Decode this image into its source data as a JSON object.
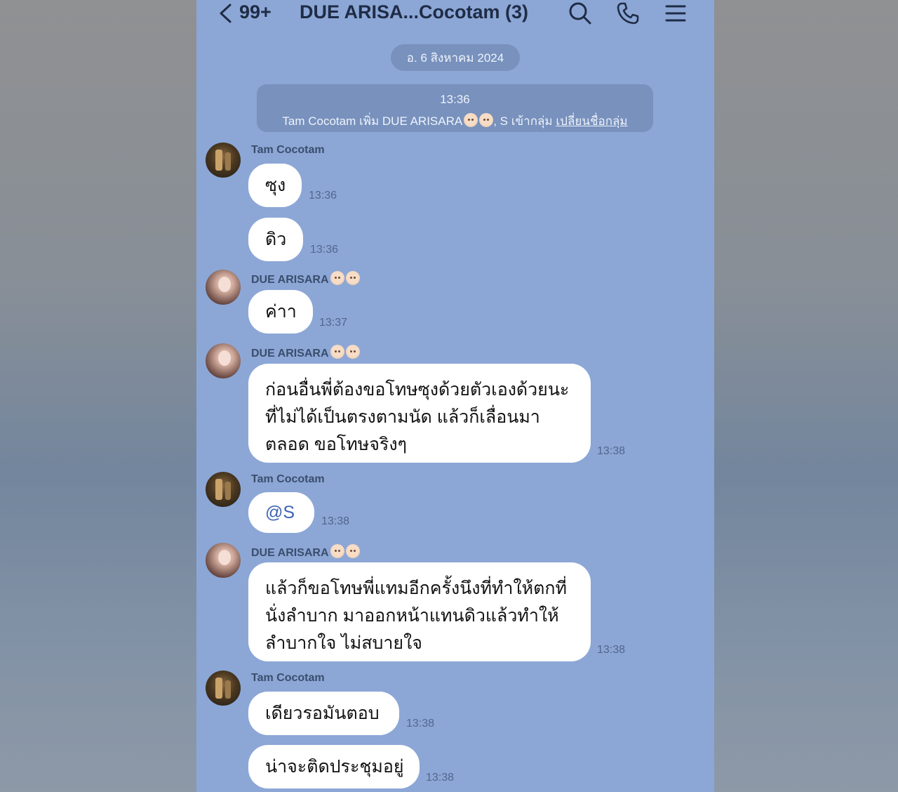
{
  "header": {
    "unread_count": "99+",
    "title": "DUE ARISA...Cocotam (3)",
    "icons": [
      "back-icon",
      "search-icon",
      "call-icon",
      "menu-icon"
    ]
  },
  "date_label": "อ. 6 สิงหาคม 2024",
  "system_notice": {
    "time": "13:36",
    "text_before": "Tam Cocotam เพิ่ม DUE ARISARA",
    "text_after": ", S เข้ากลุ่ม",
    "link": "เปลี่ยนชื่อกลุ่ม"
  },
  "senders": {
    "tam": "Tam Cocotam",
    "due": "DUE ARISARA"
  },
  "messages": [
    {
      "text": "ซุง",
      "time": "13:36"
    },
    {
      "text": "ดิว",
      "time": "13:36"
    },
    {
      "text": "ค่าา",
      "time": "13:37"
    },
    {
      "text": "ก่อนอื่นพี่ต้องขอโทษซุงด้วยตัวเองด้วยนะ ที่ไม่ได้เป็นตรงตามนัด แล้วก็เลื่อนมาตลอด ขอโทษจริงๆ",
      "time": "13:38"
    },
    {
      "text": "@S",
      "time": "13:38"
    },
    {
      "text": "แล้วก็ขอโทษพี่แทมอีกครั้งนึงที่ทำให้ตกที่นั่งลำบาก มาออกหน้าแทนดิวแล้วทำให้ลำบากใจ ไม่สบายใจ",
      "time": "13:38"
    },
    {
      "text": "เดียวรอมันตอบ",
      "time": "13:38"
    },
    {
      "text": "น่าจะติดประชุมอยู่",
      "time": "13:38"
    }
  ],
  "colors": {
    "chat_background": "#8ca7d6",
    "bubble": "#ffffff",
    "pill": "#7891bd",
    "mention": "#3c63b4"
  }
}
